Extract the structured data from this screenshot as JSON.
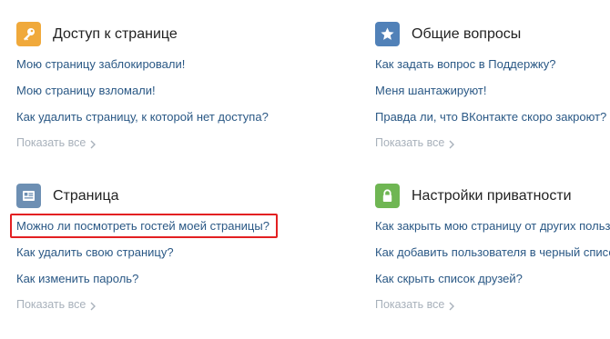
{
  "colors": {
    "link": "#2a5885",
    "muted": "#a8b1bb",
    "title": "#222222",
    "highlight": "#e32022",
    "icon_access": "#f0a93b",
    "icon_faq": "#5181b8",
    "icon_page": "#6d8fb3",
    "icon_privacy": "#6fb653"
  },
  "sections": [
    {
      "title": "Доступ к странице",
      "icon": "key-icon",
      "links": [
        "Мою страницу заблокировали!",
        "Мою страницу взломали!",
        "Как удалить страницу, к которой нет доступа?"
      ],
      "more": "Показать все"
    },
    {
      "title": "Общие вопросы",
      "icon": "star-icon",
      "links": [
        "Как задать вопрос в Поддержку?",
        "Меня шантажируют!",
        "Правда ли, что ВКонтакте скоро закроют?"
      ],
      "more": "Показать все"
    },
    {
      "title": "Страница",
      "icon": "profile-card-icon",
      "links": [
        "Можно ли посмотреть гостей моей страницы?",
        "Как удалить свою страницу?",
        "Как изменить пароль?"
      ],
      "more": "Показать все"
    },
    {
      "title": "Настройки приватности",
      "icon": "lock-icon",
      "links": [
        "Как закрыть мою страницу от других пользователей?",
        "Как добавить пользователя в черный список?",
        "Как скрыть список друзей?"
      ],
      "more": "Показать все"
    }
  ]
}
